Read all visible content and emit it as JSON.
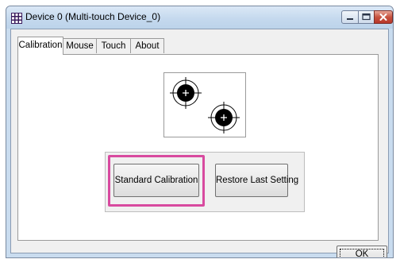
{
  "window": {
    "title": "Device 0 (Multi-touch Device_0)",
    "app_icon": "multi-touch-device-icon"
  },
  "title_buttons": {
    "minimize_icon": "minimize-icon",
    "maximize_icon": "maximize-icon",
    "close_icon": "close-icon"
  },
  "tabs": [
    {
      "label": "Calibration",
      "active": true
    },
    {
      "label": "Mouse",
      "active": false
    },
    {
      "label": "Touch",
      "active": false
    },
    {
      "label": "About",
      "active": false
    }
  ],
  "calibration": {
    "target_icon": "calibration-target-icon",
    "standard_button": "Standard Calibration",
    "restore_button": "Restore Last Setting",
    "highlight_color": "#d84a9f"
  },
  "footer": {
    "ok_button": "OK"
  }
}
